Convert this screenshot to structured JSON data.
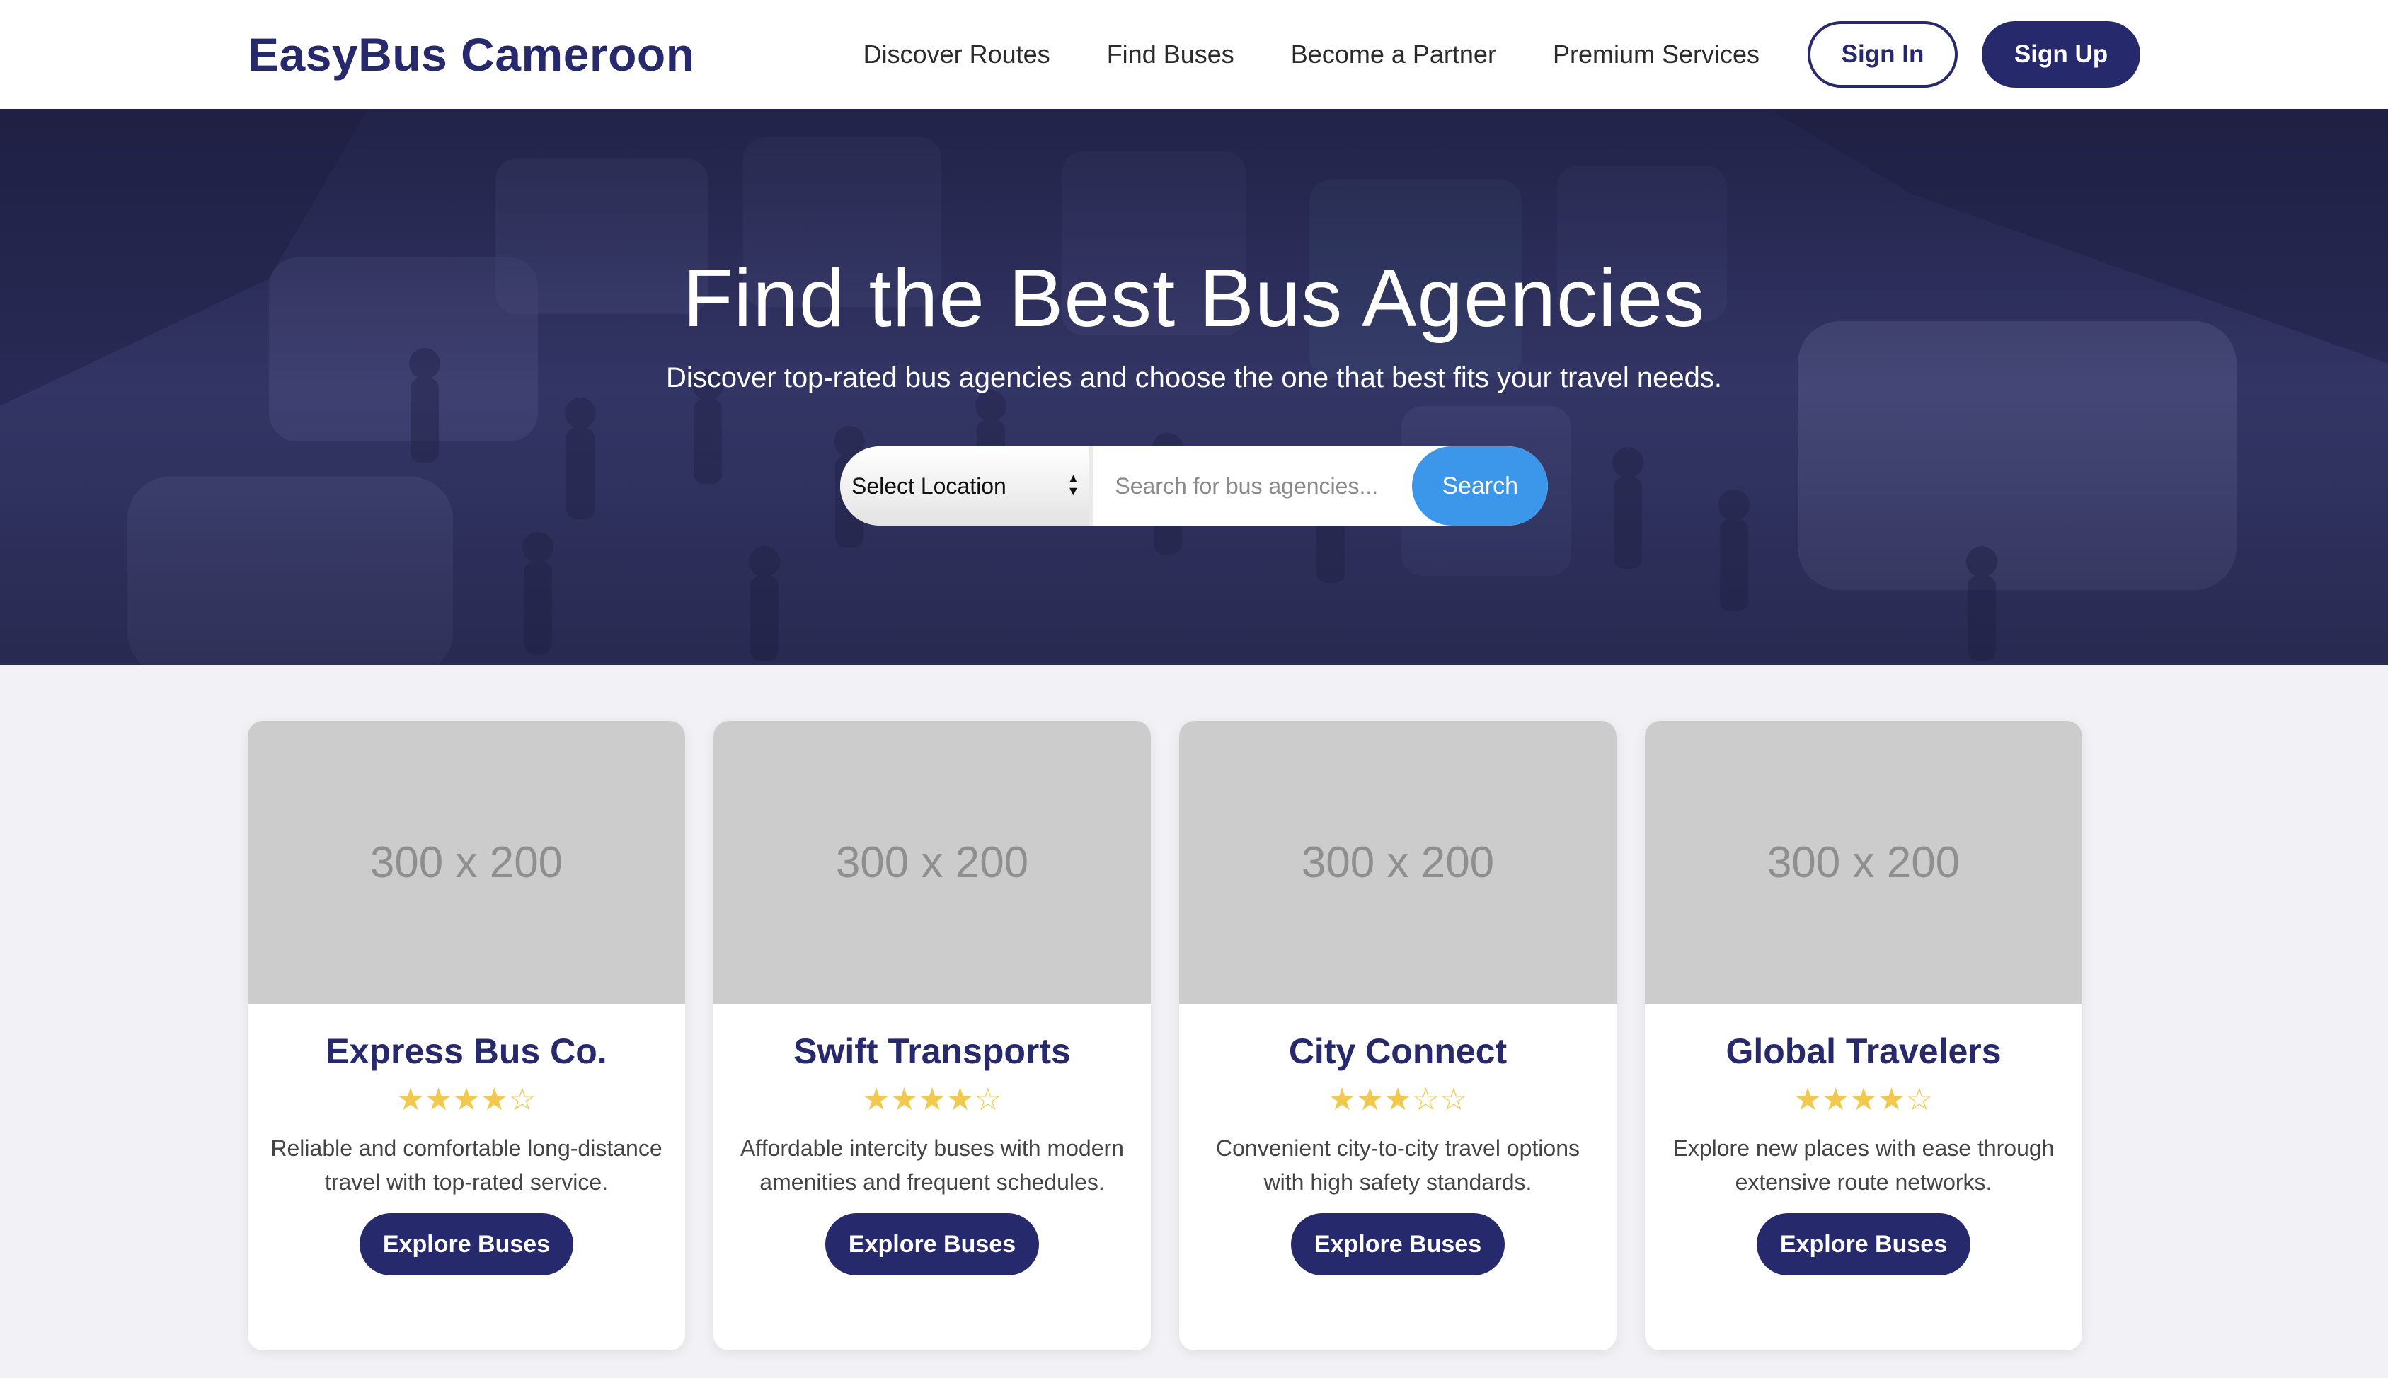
{
  "brand": {
    "name": "EasyBus Cameroon",
    "color": "#27296d"
  },
  "nav": {
    "links": [
      "Discover Routes",
      "Find Buses",
      "Become a Partner",
      "Premium Services"
    ],
    "sign_in": "Sign In",
    "sign_up": "Sign Up"
  },
  "hero": {
    "title": "Find the Best Bus Agencies",
    "subtitle": "Discover top-rated bus agencies and choose the one that best fits your travel needs.",
    "location_select": "Select Location",
    "search_placeholder": "Search for bus agencies...",
    "search_button": "Search",
    "search_button_color": "#3c97ea"
  },
  "cards": [
    {
      "image_placeholder": "300 x 200",
      "title": "Express Bus Co.",
      "rating": 4,
      "max_rating": 5,
      "stars_text": "★★★★☆",
      "description": "Reliable and comfortable long-distance travel with top-rated service.",
      "button": "Explore Buses"
    },
    {
      "image_placeholder": "300 x 200",
      "title": "Swift Transports",
      "rating": 4,
      "max_rating": 5,
      "stars_text": "★★★★☆",
      "description": "Affordable intercity buses with modern amenities and frequent schedules.",
      "button": "Explore Buses"
    },
    {
      "image_placeholder": "300 x 200",
      "title": "City Connect",
      "rating": 3,
      "max_rating": 5,
      "stars_text": "★★★☆☆",
      "description": "Convenient city-to-city travel options with high safety standards.",
      "button": "Explore Buses"
    },
    {
      "image_placeholder": "300 x 200",
      "title": "Global Travelers",
      "rating": 4,
      "max_rating": 5,
      "stars_text": "★★★★☆",
      "description": "Explore new places with ease through extensive route networks.",
      "button": "Explore Buses"
    }
  ],
  "icons": {
    "select_arrows": "updown-arrows-icon",
    "star": "star-icon"
  },
  "colors": {
    "star": "#f2c94c",
    "card_image": "#cccccc",
    "page_bg": "#f2f2f6"
  }
}
